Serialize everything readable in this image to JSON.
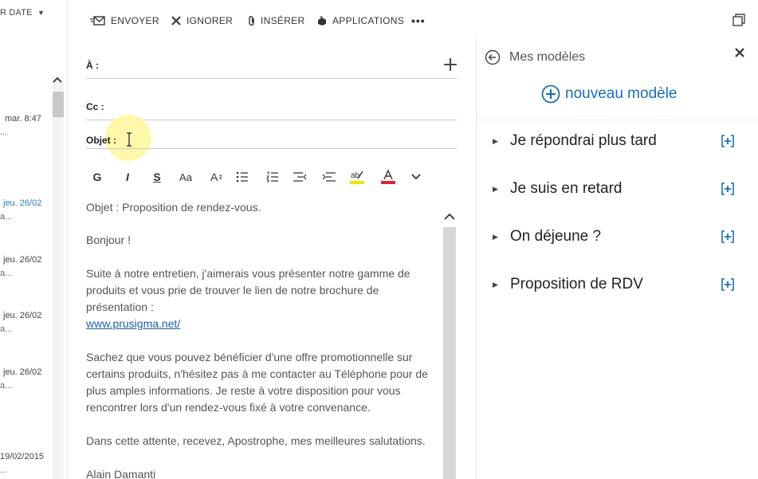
{
  "mail_list": {
    "sort_label": "R DATE",
    "items": [
      {
        "date": "mar. 8:47",
        "snippet": "...",
        "unread": false
      },
      {
        "date": "jeu. 26/02",
        "snippet": "a...",
        "unread": true
      },
      {
        "date": "jeu. 26/02",
        "snippet": "a...",
        "unread": false
      },
      {
        "date": "jeu. 26/02",
        "snippet": "a...",
        "unread": false
      },
      {
        "date": "jeu. 26/02",
        "snippet": "a...",
        "unread": false
      },
      {
        "date": "19/02/2015",
        "snippet": "...",
        "unread": false
      }
    ]
  },
  "toolbar": {
    "send": "ENVOYER",
    "ignore": "IGNORER",
    "insert": "INSÉRER",
    "apps": "APPLICATIONS",
    "more": "•••"
  },
  "compose": {
    "to_label": "À :",
    "cc_label": "Cc :",
    "subject_label": "Objet :",
    "subject_value": "",
    "body": {
      "line1": "Objet : Proposition de rendez-vous.",
      "greeting": "Bonjour !",
      "para1": "Suite à notre entretien, j'aimerais vous présenter notre gamme de produits et vous prie de trouver le lien de notre brochure de présentation :",
      "link": "www.prusigma.net/",
      "para2": "Sachez que vous pouvez bénéficier d'une offre promotionnelle sur certains produits, n'hésitez pas à me contacter au Téléphone pour de plus amples informations. Je reste à votre disposition pour vous rencontrer lors d'un rendez-vous fixé à votre convenance.",
      "para3": "Dans cette attente, recevez, Apostrophe, mes meilleures salutations.",
      "signature": "Alain Damanti"
    }
  },
  "format_toolbar": {
    "bold": "G",
    "italic": "I",
    "underline": "S",
    "font_size": "Aa",
    "grow": "A"
  },
  "templates": {
    "title": "Mes modèles",
    "new_label": "nouveau modèle",
    "items": [
      "Je répondrai plus tard",
      "Je suis en retard",
      "On déjeune ?",
      "Proposition de RDV"
    ]
  },
  "colors": {
    "accent": "#1a6fb5",
    "highlight_yellow": "#f2e200",
    "font_red": "#d9272e",
    "cursor_halo": "#fff6a0"
  }
}
